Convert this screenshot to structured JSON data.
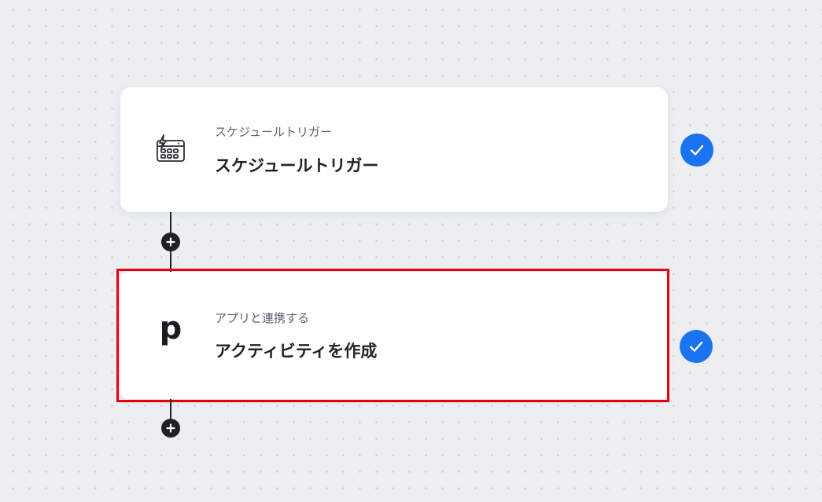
{
  "flow": {
    "steps": [
      {
        "subtitle": "スケジュールトリガー",
        "title": "スケジュールトリガー",
        "icon": "calendar-lightning-icon",
        "status": "completed-check-icon"
      },
      {
        "subtitle": "アプリと連携する",
        "title": "アクティビティを作成",
        "icon_text": "p",
        "icon": "pipedrive-logo-icon",
        "status": "completed-check-icon",
        "highlight_color": "#e8000b"
      }
    ],
    "colors": {
      "check": "#1a73f0",
      "connector": "#1e2126",
      "background": "#eceef2"
    }
  }
}
